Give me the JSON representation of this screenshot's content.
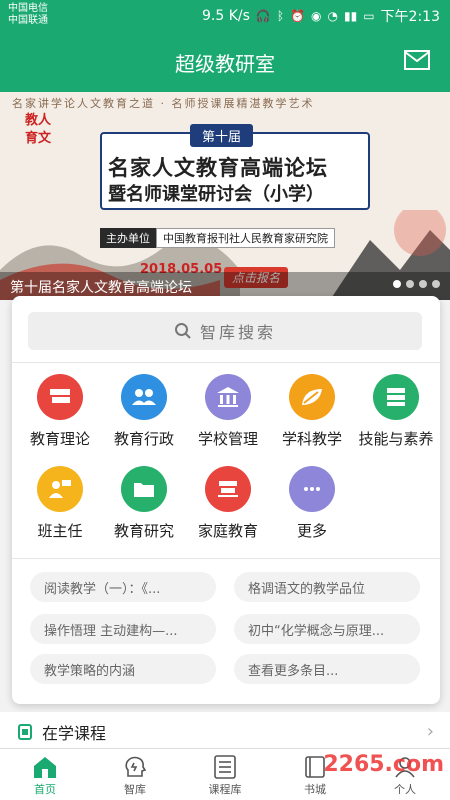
{
  "status": {
    "carrier1": "中国电信",
    "carrier2": "中国联通",
    "speed": "9.5 K/s",
    "time": "下午2:13"
  },
  "appbar": {
    "title": "超级教研室",
    "mail_icon": "mail-icon"
  },
  "banner": {
    "tagline": "名家讲学论人文教育之道 · 名师授课展精湛教学艺术",
    "seal": "教人育文",
    "edition": "第十届",
    "line1": "名家人文教育高端论坛",
    "line2": "暨名师课堂研讨会（小学）",
    "host_label": "主办单位",
    "host_value": "中国教育报刊社人民教育家研究院",
    "date": "2018.05.05",
    "register": "点击报名",
    "caption": "第十届名家人文教育高端论坛",
    "pagination_active": 1,
    "pagination_count": 4
  },
  "search": {
    "placeholder": "智库搜索"
  },
  "categories": [
    {
      "label": "教育理论",
      "color": "#e9453f",
      "icon": "books-icon"
    },
    {
      "label": "教育行政",
      "color": "#2f8fe0",
      "icon": "people-icon"
    },
    {
      "label": "学校管理",
      "color": "#8e86d8",
      "icon": "building-icon"
    },
    {
      "label": "学科教学",
      "color": "#f4a11a",
      "icon": "leaf-icon"
    },
    {
      "label": "技能与素养",
      "color": "#27b06b",
      "icon": "stack-icon"
    },
    {
      "label": "班主任",
      "color": "#f5b41c",
      "icon": "teacher-icon"
    },
    {
      "label": "教育研究",
      "color": "#27b06b",
      "icon": "folder-icon"
    },
    {
      "label": "家庭教育",
      "color": "#e9453f",
      "icon": "shelf-icon"
    },
    {
      "label": "更多",
      "color": "#8e86d8",
      "icon": "more-icon"
    }
  ],
  "tags": [
    "阅读教学（一）：《...",
    "格调语文的教学品位",
    "操作悟理 主动建构—...",
    "初中“化学概念与原理...",
    "教学策略的内涵",
    "查看更多条目..."
  ],
  "course": {
    "title": "在学课程"
  },
  "nav": [
    {
      "label": "首页",
      "active": true
    },
    {
      "label": "智库",
      "active": false
    },
    {
      "label": "课程库",
      "active": false
    },
    {
      "label": "书城",
      "active": false
    },
    {
      "label": "个人",
      "active": false
    }
  ],
  "watermark": "2265.com"
}
